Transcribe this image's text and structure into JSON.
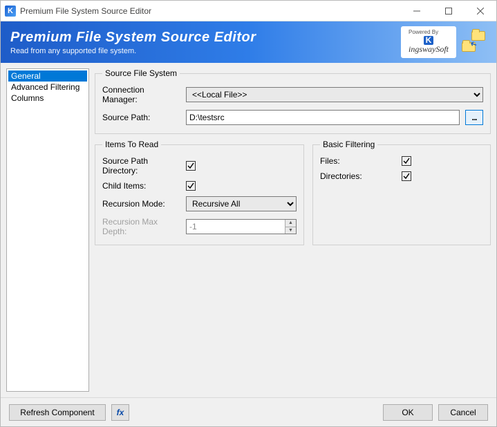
{
  "window": {
    "title": "Premium File System Source Editor",
    "app_icon_letter": "K"
  },
  "banner": {
    "title": "Premium File System Source Editor",
    "subtitle": "Read from any supported file system.",
    "powered_by": "Powered By",
    "brand_k": "K",
    "brand_rest": "ingswaySoft"
  },
  "nav": {
    "items": [
      {
        "label": "General",
        "selected": true
      },
      {
        "label": "Advanced Filtering",
        "selected": false
      },
      {
        "label": "Columns",
        "selected": false
      }
    ]
  },
  "source_file_system": {
    "legend": "Source File System",
    "connection_manager_label": "Connection Manager:",
    "connection_manager_value": "<<Local File>>",
    "source_path_label": "Source Path:",
    "source_path_value": "D:\\testsrc",
    "browse_label": "..."
  },
  "items_to_read": {
    "legend": "Items To Read",
    "source_path_directory_label": "Source Path Directory:",
    "source_path_directory_checked": true,
    "child_items_label": "Child Items:",
    "child_items_checked": true,
    "recursion_mode_label": "Recursion Mode:",
    "recursion_mode_value": "Recursive All",
    "recursion_max_depth_label": "Recursion Max Depth:",
    "recursion_max_depth_value": "-1",
    "recursion_max_depth_enabled": false
  },
  "basic_filtering": {
    "legend": "Basic Filtering",
    "files_label": "Files:",
    "files_checked": true,
    "directories_label": "Directories:",
    "directories_checked": true
  },
  "footer": {
    "refresh_label": "Refresh Component",
    "ok_label": "OK",
    "cancel_label": "Cancel"
  }
}
